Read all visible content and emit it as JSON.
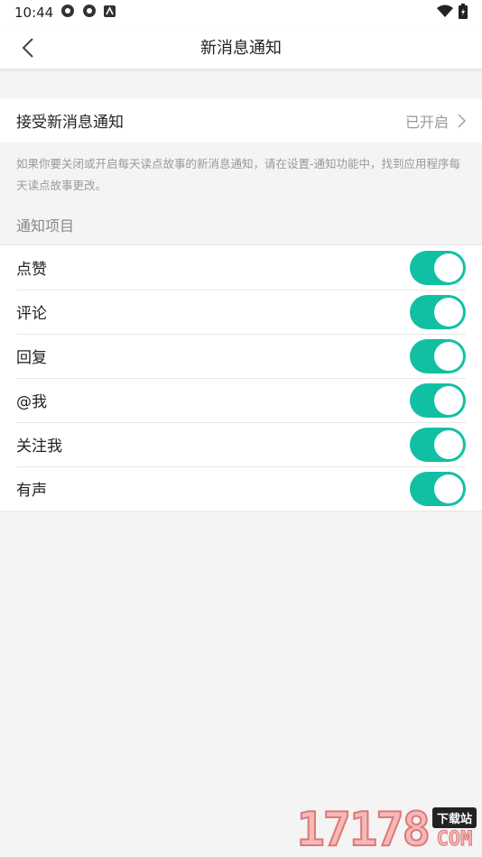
{
  "status": {
    "time": "10:44"
  },
  "header": {
    "title": "新消息通知"
  },
  "receive": {
    "label": "接受新消息通知",
    "value": "已开启"
  },
  "hint": "如果你要关闭或开启每天读点故事的新消息通知，请在设置-通知功能中，找到应用程序每天读点故事更改。",
  "section_label": "通知项目",
  "items": [
    {
      "label": "点赞",
      "on": true
    },
    {
      "label": "评论",
      "on": true
    },
    {
      "label": "回复",
      "on": true
    },
    {
      "label": "@我",
      "on": true
    },
    {
      "label": "关注我",
      "on": true
    },
    {
      "label": "有声",
      "on": true
    }
  ],
  "colors": {
    "toggle_on": "#11c0a3"
  },
  "watermark": {
    "number": "17178",
    "badge": "下载站",
    "suffix": "COM"
  }
}
